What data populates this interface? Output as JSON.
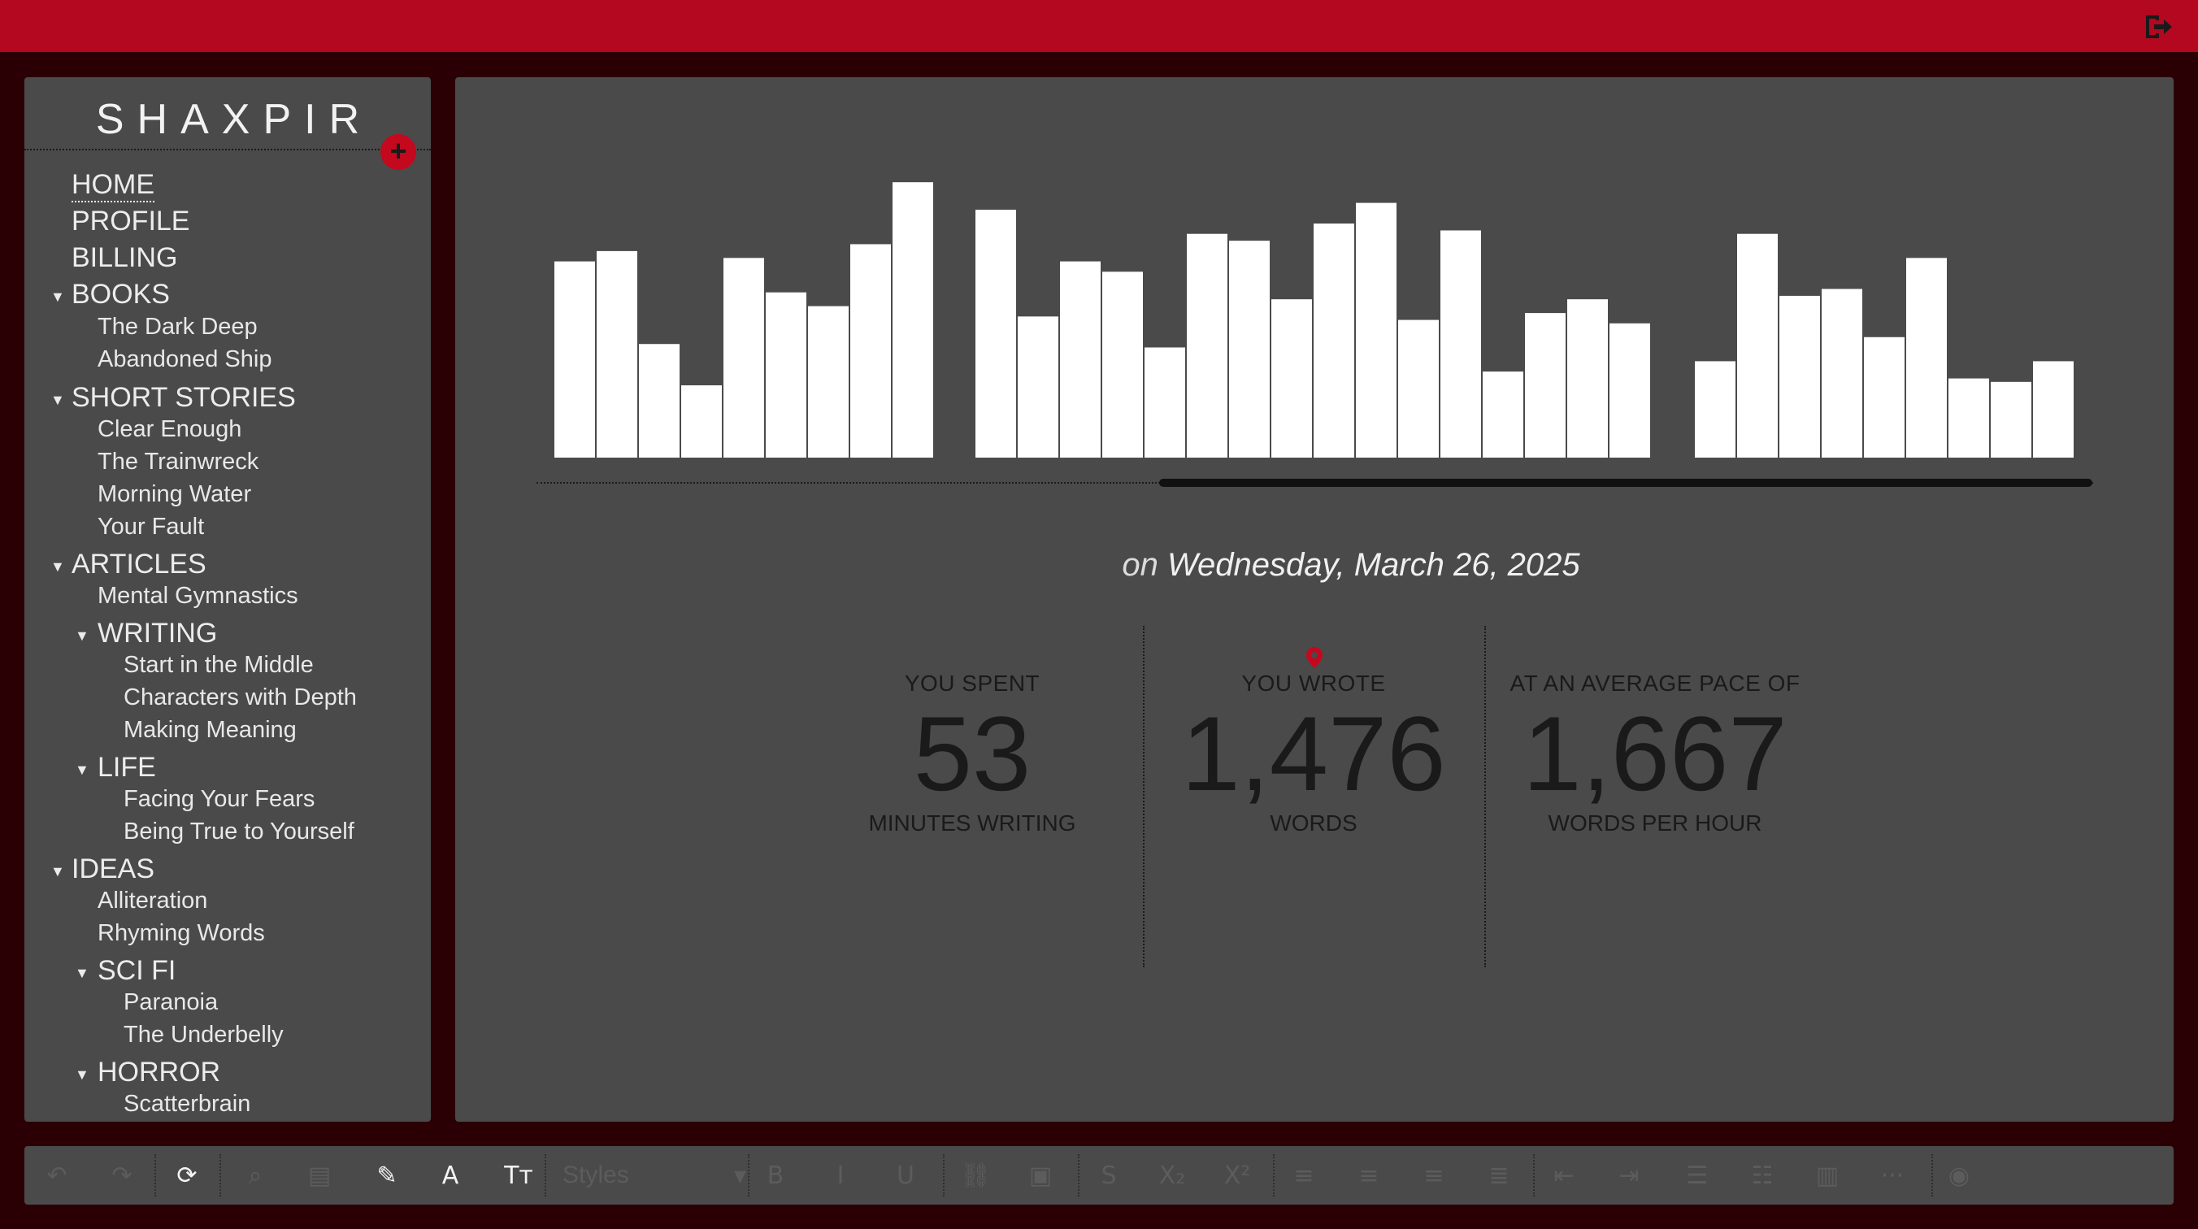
{
  "app": {
    "brand": "SHAXPIR",
    "add_button": "+",
    "colors": {
      "accent": "#c4081e",
      "topbar": "#b30820",
      "panel": "#4a4a4a",
      "background": "#2a0005"
    },
    "logout_icon": "logout-icon"
  },
  "sidebar": {
    "items": [
      {
        "label": "HOME",
        "level": 0,
        "active": true
      },
      {
        "label": "PROFILE",
        "level": 0
      },
      {
        "label": "BILLING",
        "level": 0
      },
      {
        "label": "BOOKS",
        "level": 0,
        "expandable": true
      },
      {
        "label": "The Dark Deep",
        "level": 1
      },
      {
        "label": "Abandoned Ship",
        "level": 1
      },
      {
        "label": "SHORT STORIES",
        "level": 0,
        "expandable": true
      },
      {
        "label": "Clear Enough",
        "level": 1
      },
      {
        "label": "The Trainwreck",
        "level": 1
      },
      {
        "label": "Morning Water",
        "level": 1
      },
      {
        "label": "Your Fault",
        "level": 1
      },
      {
        "label": "ARTICLES",
        "level": 0,
        "expandable": true
      },
      {
        "label": "Mental Gymnastics",
        "level": 1
      },
      {
        "label": "WRITING",
        "level": 1,
        "expandable": true
      },
      {
        "label": "Start in the Middle",
        "level": 2
      },
      {
        "label": "Characters with Depth",
        "level": 2
      },
      {
        "label": "Making Meaning",
        "level": 2
      },
      {
        "label": "LIFE",
        "level": 1,
        "expandable": true
      },
      {
        "label": "Facing Your Fears",
        "level": 2
      },
      {
        "label": "Being True to Yourself",
        "level": 2
      },
      {
        "label": "IDEAS",
        "level": 0,
        "expandable": true
      },
      {
        "label": "Alliteration",
        "level": 1
      },
      {
        "label": "Rhyming Words",
        "level": 1
      },
      {
        "label": "SCI FI",
        "level": 1,
        "expandable": true
      },
      {
        "label": "Paranoia",
        "level": 2
      },
      {
        "label": "The Underbelly",
        "level": 2
      },
      {
        "label": "HORROR",
        "level": 1,
        "expandable": true
      },
      {
        "label": "Scatterbrain",
        "level": 2
      }
    ]
  },
  "chart_data": {
    "type": "bar",
    "title": "",
    "xlabel": "",
    "ylabel": "",
    "grid": false,
    "selected_index": 34,
    "selected_color": "#b30820",
    "bar_color": "#ffffff",
    "groups": [
      [
        5.7,
        6.0,
        3.3,
        2.1,
        5.8,
        4.8,
        4.4,
        6.2,
        8.0
      ],
      [
        7.2,
        4.1,
        5.7,
        5.4,
        3.2,
        6.5,
        6.3,
        4.6,
        6.8,
        7.4,
        4.0,
        6.6,
        2.5,
        4.2,
        4.6,
        3.9
      ],
      [
        2.8,
        6.5,
        4.7,
        4.9,
        3.5,
        5.8,
        2.3,
        2.2,
        2.8
      ]
    ],
    "ylim": [
      0,
      8.5
    ]
  },
  "summary": {
    "date_prefix": "on",
    "date": "Wednesday, March 26, 2025",
    "stats": [
      {
        "label": "YOU SPENT",
        "value": "53",
        "unit": "MINUTES WRITING"
      },
      {
        "label": "YOU WROTE",
        "value": "1,476",
        "unit": "WORDS"
      },
      {
        "label": "AT AN AVERAGE PACE OF",
        "value": "1,667",
        "unit": "WORDS PER HOUR"
      }
    ]
  },
  "toolbar": {
    "styles_label": "Styles",
    "buttons": [
      {
        "name": "undo-icon",
        "glyph": "↶",
        "enabled": false
      },
      {
        "name": "redo-icon",
        "glyph": "↷",
        "enabled": false
      },
      {
        "name": "sync-icon",
        "glyph": "⟳",
        "enabled": true
      },
      {
        "name": "search-icon",
        "glyph": "⌕",
        "enabled": false
      },
      {
        "name": "save-icon",
        "glyph": "▤",
        "enabled": false
      },
      {
        "name": "highlighter-icon",
        "glyph": "✎",
        "enabled": true
      },
      {
        "name": "font-color-icon",
        "glyph": "A",
        "enabled": true
      },
      {
        "name": "text-size-icon",
        "glyph": "Tт",
        "enabled": true
      },
      {
        "name": "bold-icon",
        "glyph": "B",
        "enabled": false
      },
      {
        "name": "italic-icon",
        "glyph": "I",
        "enabled": false
      },
      {
        "name": "underline-icon",
        "glyph": "U",
        "enabled": false
      },
      {
        "name": "link-icon",
        "glyph": "⛓",
        "enabled": false
      },
      {
        "name": "image-icon",
        "glyph": "▣",
        "enabled": false
      },
      {
        "name": "strikethrough-icon",
        "glyph": "S",
        "enabled": false
      },
      {
        "name": "subscript-icon",
        "glyph": "X₂",
        "enabled": false
      },
      {
        "name": "superscript-icon",
        "glyph": "X²",
        "enabled": false
      },
      {
        "name": "align-left-icon",
        "glyph": "≡",
        "enabled": false
      },
      {
        "name": "align-center-icon",
        "glyph": "≡",
        "enabled": false
      },
      {
        "name": "align-right-icon",
        "glyph": "≡",
        "enabled": false
      },
      {
        "name": "align-justify-icon",
        "glyph": "≣",
        "enabled": false
      },
      {
        "name": "outdent-icon",
        "glyph": "⇤",
        "enabled": false
      },
      {
        "name": "indent-icon",
        "glyph": "⇥",
        "enabled": false
      },
      {
        "name": "ordered-list-icon",
        "glyph": "☰",
        "enabled": false
      },
      {
        "name": "bullet-list-icon",
        "glyph": "☷",
        "enabled": false
      },
      {
        "name": "columns-icon",
        "glyph": "▥",
        "enabled": false
      },
      {
        "name": "more-icon",
        "glyph": "···",
        "enabled": false
      },
      {
        "name": "audio-icon",
        "glyph": "◉",
        "enabled": false
      }
    ]
  }
}
